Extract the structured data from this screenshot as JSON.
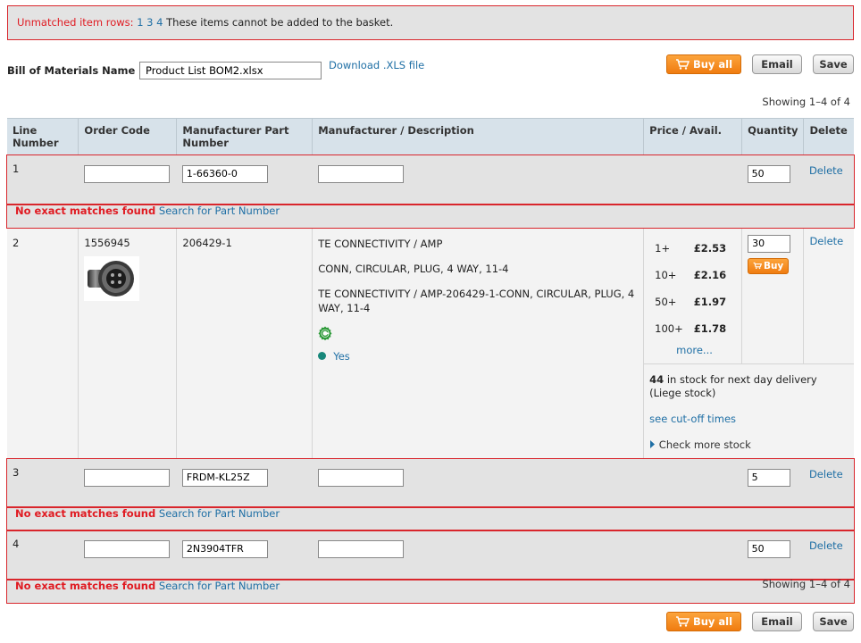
{
  "alert": {
    "prefix": "Unmatched item rows:",
    "rows": [
      "1",
      "3",
      "4"
    ],
    "suffix": "These items cannot be added to the basket."
  },
  "bom": {
    "label": "Bill of Materials Name",
    "value": "Product List BOM2.xlsx",
    "download_label": "Download .XLS file"
  },
  "buttons": {
    "buy_all": "Buy all",
    "email": "Email",
    "save": "Save",
    "buy": "Buy"
  },
  "showing": "Showing 1–4 of 4",
  "table": {
    "headers": [
      "Line Number",
      "Order Code",
      "Manufacturer Part Number",
      "Manufacturer / Description",
      "Price / Avail.",
      "Quantity",
      "Delete"
    ],
    "delete_label": "Delete",
    "no_match_label": "No exact matches found",
    "search_label": "Search for Part Number"
  },
  "rows": [
    {
      "line": "1",
      "order_code": "",
      "mpn": "1-66360-0",
      "description": "",
      "quantity": "50"
    },
    {
      "line": "2",
      "order_code": "1556945",
      "mpn": "206429-1",
      "manufacturer": "TE CONNECTIVITY / AMP",
      "desc_short": "CONN, CIRCULAR, PLUG, 4 WAY, 11-4",
      "desc_full": "TE CONNECTIVITY / AMP-206429-1-CONN, CIRCULAR, PLUG, 4 WAY, 11-4",
      "rohs_label": "Yes",
      "prices": [
        {
          "break": "1+",
          "price": "£2.53"
        },
        {
          "break": "10+",
          "price": "£2.16"
        },
        {
          "break": "50+",
          "price": "£1.97"
        },
        {
          "break": "100+",
          "price": "£1.78"
        }
      ],
      "more_label": "more...",
      "quantity": "30",
      "stock_count": "44",
      "stock_text": "in stock for next day delivery (Liege stock)",
      "cutoff_label": "see cut-off times",
      "check_stock_label": "Check more stock"
    },
    {
      "line": "3",
      "order_code": "",
      "mpn": "FRDM-KL25Z",
      "description": "",
      "quantity": "5"
    },
    {
      "line": "4",
      "order_code": "",
      "mpn": "2N3904TFR",
      "description": "",
      "quantity": "50"
    }
  ],
  "colors": {
    "alert_border": "#d9262c",
    "accent_orange": "#f07c10",
    "link": "#1f6fa5",
    "header_bg": "#d7e2ea"
  }
}
